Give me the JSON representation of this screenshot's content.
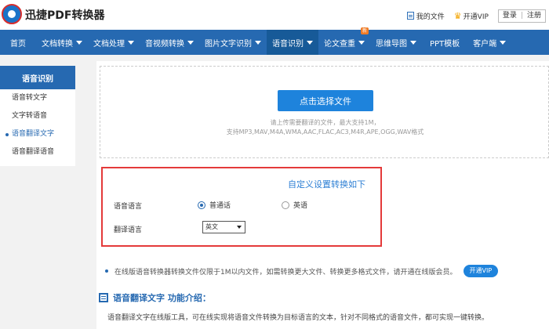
{
  "header": {
    "brand": "迅捷PDF转换器",
    "my_files": "我的文件",
    "open_vip": "开通VIP",
    "login": "登录",
    "separator": "|",
    "register": "注册"
  },
  "nav": {
    "items": [
      {
        "label": "首页",
        "dropdown": false
      },
      {
        "label": "文档转换",
        "dropdown": true
      },
      {
        "label": "文档处理",
        "dropdown": true
      },
      {
        "label": "音视频转换",
        "dropdown": true
      },
      {
        "label": "图片文字识别",
        "dropdown": true
      },
      {
        "label": "语音识别",
        "dropdown": true,
        "active": true
      },
      {
        "label": "论文查重",
        "dropdown": true,
        "badge": "新"
      },
      {
        "label": "思维导图",
        "dropdown": true
      },
      {
        "label": "PPT模板",
        "dropdown": false
      },
      {
        "label": "客户端",
        "dropdown": true
      }
    ]
  },
  "sidebar": {
    "title": "语音识别",
    "items": [
      {
        "label": "语音转文字"
      },
      {
        "label": "文字转语音"
      },
      {
        "label": "语音翻译文字",
        "active": true
      },
      {
        "label": "语音翻译语音"
      }
    ]
  },
  "upload": {
    "button_label": "点击选择文件",
    "hint_line1": "请上传需要翻译的文件，最大支持1M，",
    "hint_line2": "支持MP3,MAV,M4A,WMA,AAC,FLAC,AC3,M4R,APE,OGG,WAV格式"
  },
  "settings": {
    "title": "自定义设置转换如下",
    "voice_language_label": "语音语言",
    "options": [
      {
        "label": "普通话",
        "checked": true
      },
      {
        "label": "英语",
        "checked": false
      }
    ],
    "translate_language_label": "翻译语言",
    "translate_selected": "英文"
  },
  "notice": {
    "text": "在线版语音转换器转换文件仅限于1M以内文件，如需转换更大文件、转换更多格式文件，请开通在线版会员。",
    "button": "开通VIP"
  },
  "intro": {
    "title": "语音翻译文字 功能介绍：",
    "text": "语音翻译文字在线版工具，可在线实现将语音文件转换为目标语言的文本，针对不同格式的语音文件，都可实现一键转换。"
  },
  "colors": {
    "nav_bg": "#2669b1",
    "accent_blue": "#1e83dc",
    "highlight_border": "#e43a3a",
    "badge_orange": "#f07b25"
  }
}
